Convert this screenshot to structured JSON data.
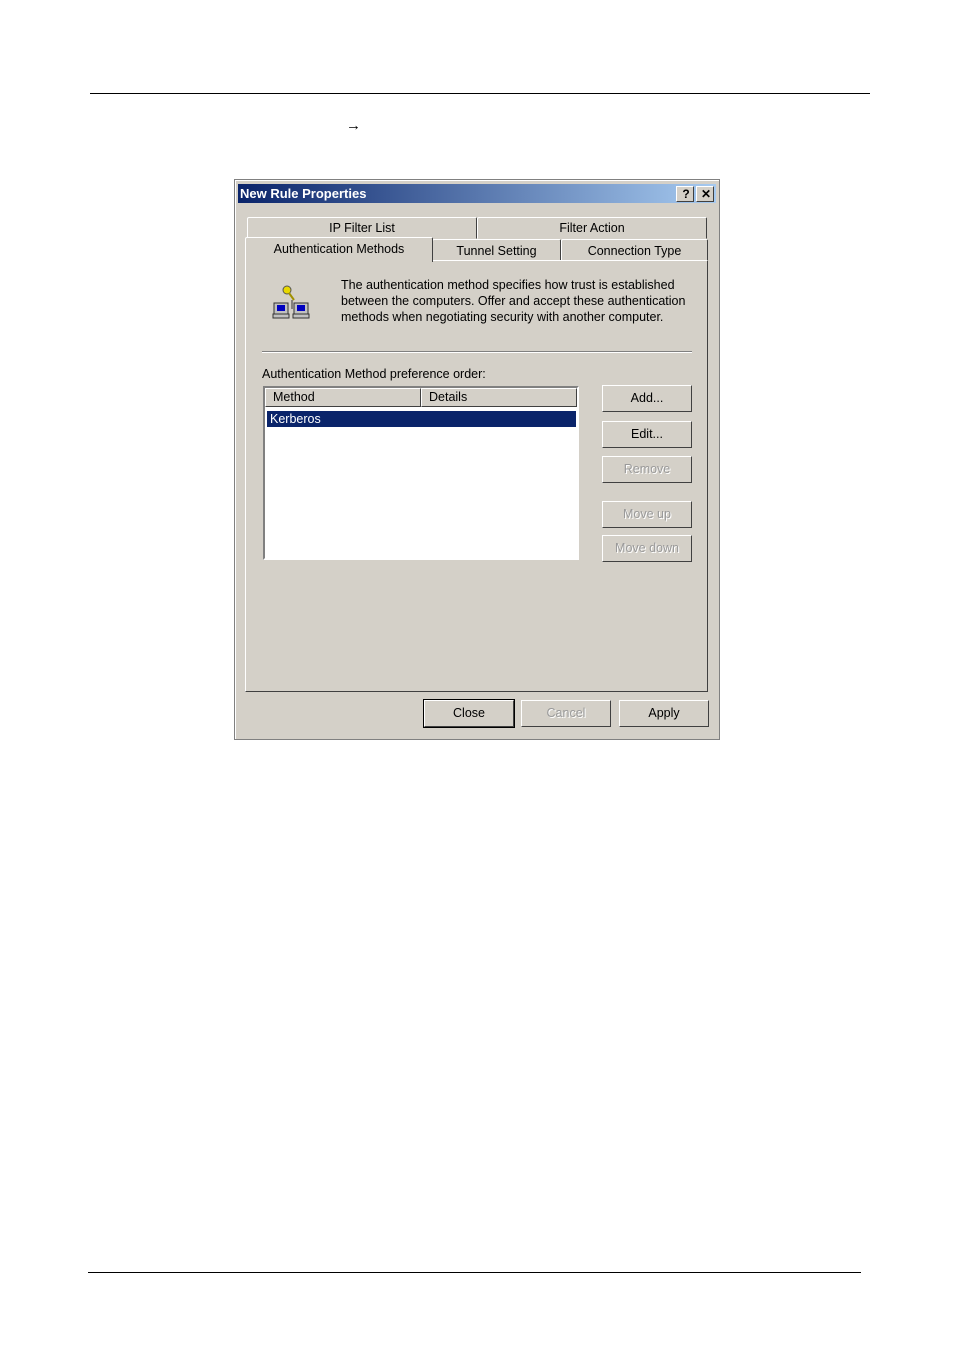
{
  "page": {
    "arrow_glyph": "→"
  },
  "dialog": {
    "title": "New Rule Properties",
    "help_button": "?",
    "close_button": "✕",
    "tabs_row1": [
      "IP Filter List",
      "Filter Action"
    ],
    "tabs_row2": [
      "Authentication Methods",
      "Tunnel Setting",
      "Connection Type"
    ],
    "active_tab": "Authentication Methods",
    "description": "The authentication method specifies how trust is established between the computers. Offer and accept these authentication methods when negotiating security with another computer.",
    "icon": "networked-computers-key-icon",
    "list_label": "Authentication Method preference order:",
    "columns": [
      "Method",
      "Details"
    ],
    "rows": [
      {
        "method": "Kerberos",
        "details": "",
        "selected": true
      }
    ],
    "side_buttons": {
      "add": "Add...",
      "edit": "Edit...",
      "remove": "Remove",
      "move_up": "Move up",
      "move_down": "Move down"
    },
    "footer_buttons": {
      "close": "Close",
      "cancel": "Cancel",
      "apply": "Apply"
    },
    "selection_color": "#0a246a"
  }
}
